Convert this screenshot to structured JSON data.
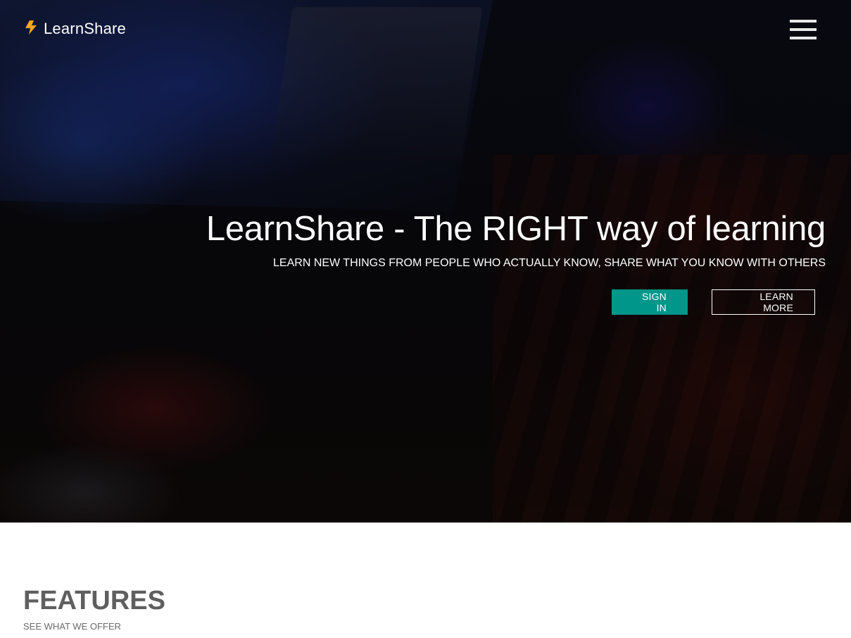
{
  "navbar": {
    "brand_icon": "lightning-bolt-icon",
    "brand_name": "LearnShare",
    "menu_icon": "hamburger-menu-icon"
  },
  "hero": {
    "title": "LearnShare - The RIGHT way of learning",
    "subtitle": "LEARN NEW THINGS FROM PEOPLE WHO ACTUALLY KNOW, SHARE WHAT YOU KNOW WITH OTHERS",
    "sign_in_label": "SIGN IN",
    "learn_more_label": "LEARN MORE"
  },
  "features": {
    "title": "FEATURES",
    "subtitle": "SEE WHAT WE OFFER"
  },
  "colors": {
    "accent": "#00968a",
    "brand_icon": "#f5a623",
    "heading_gray": "#5f5f5f"
  }
}
